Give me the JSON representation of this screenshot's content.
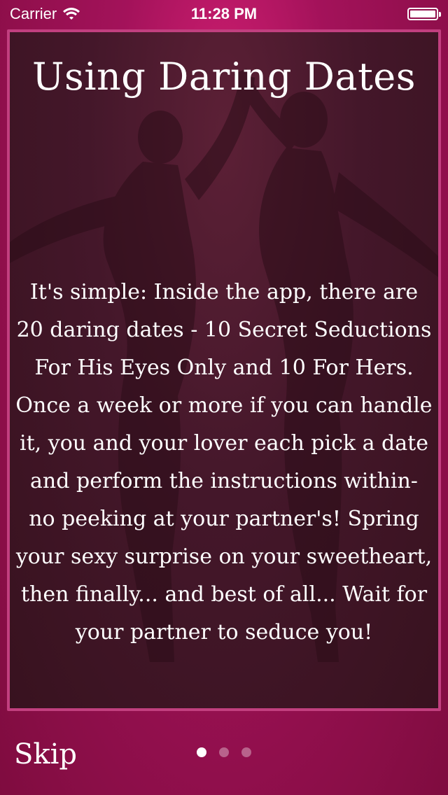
{
  "status_bar": {
    "carrier": "Carrier",
    "time": "11:28 PM"
  },
  "card": {
    "title": "Using Daring Dates",
    "body": "It's simple: Inside the app, there are 20 daring dates - 10 Secret Seductions For His Eyes Only and 10 For Hers. Once a week or more if you can handle it, you and your lover each pick a date and perform the instructions within- no peeking at your partner's!  Spring your sexy surprise on your sweetheart, then finally... and best of all... Wait for your partner to seduce you!"
  },
  "footer": {
    "skip_label": "Skip",
    "pages": 3,
    "current_page": 1
  },
  "colors": {
    "background": "#a3125a",
    "card_border": "#c23f7f",
    "card_fill": "#3b1423"
  },
  "icons": [
    "wifi-icon",
    "battery-icon",
    "silhouette-illustration"
  ]
}
